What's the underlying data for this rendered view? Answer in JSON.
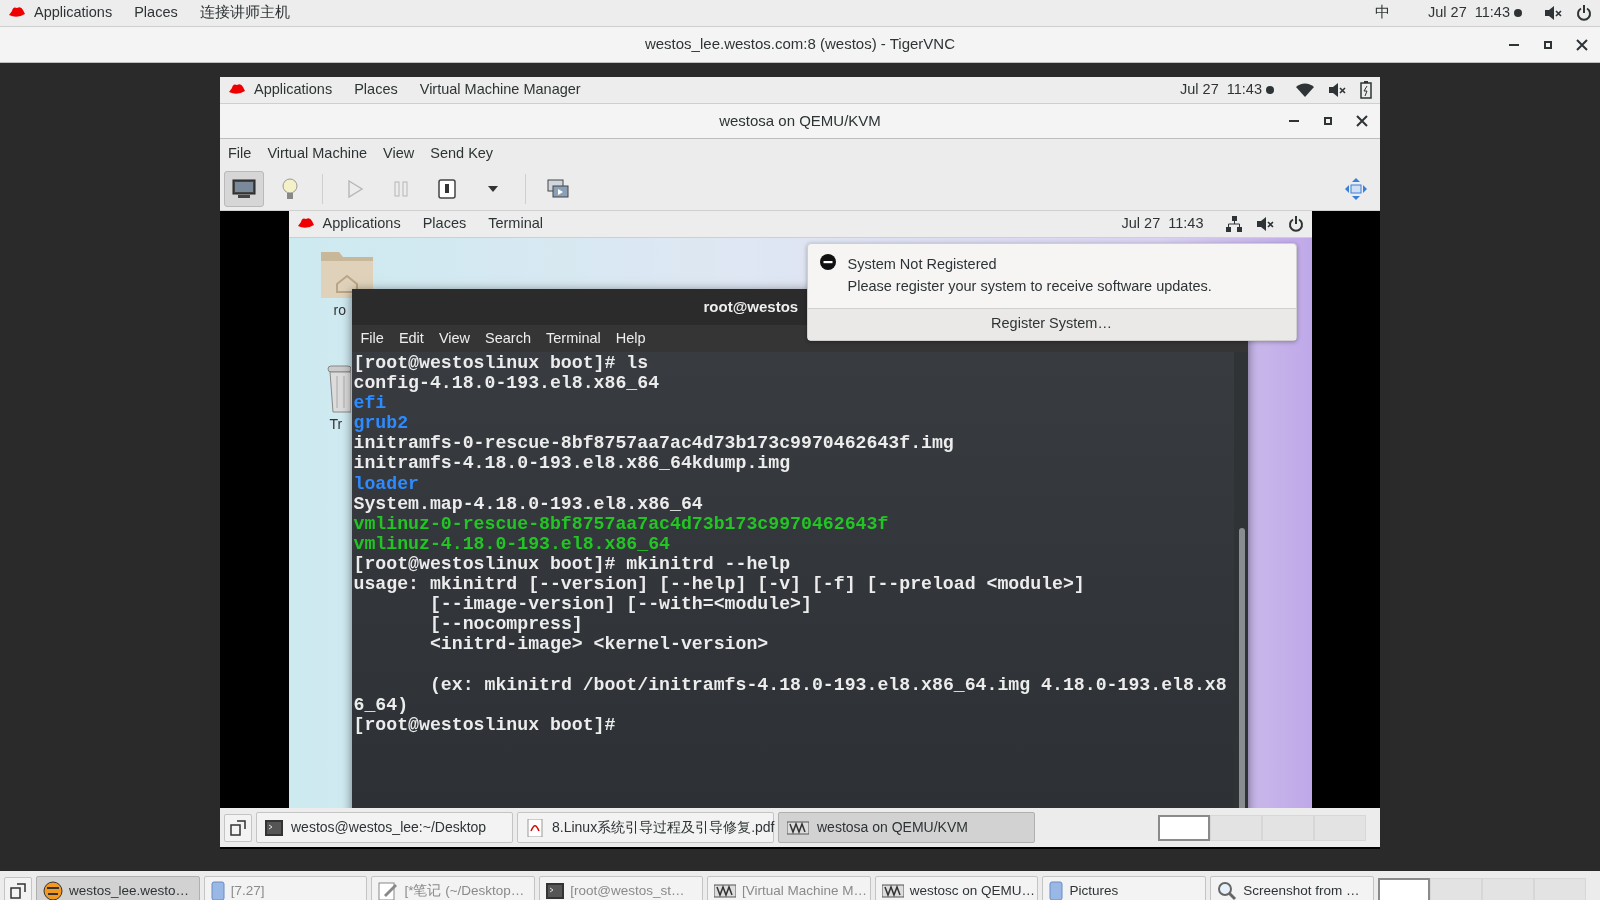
{
  "top_bar": {
    "menus": [
      "Applications",
      "Places",
      "连接讲师主机"
    ],
    "input_method": "中",
    "clock": "Jul 27  11:43"
  },
  "window": {
    "title": "westos_lee.westos.com:8 (westos) - TigerVNC"
  },
  "remote": {
    "top_bar": {
      "menus": [
        "Applications",
        "Places",
        "Virtual Machine Manager"
      ],
      "clock": "Jul 27  11:43"
    },
    "vm_window": {
      "title": "westosa on QEMU/KVM",
      "menu": [
        "File",
        "Virtual Machine",
        "View",
        "Send Key"
      ],
      "toolbar": [
        {
          "kind": "console",
          "selected": true,
          "disabled": false
        },
        {
          "kind": "details",
          "selected": false,
          "disabled": false
        },
        {
          "kind": "run",
          "selected": false,
          "disabled": true
        },
        {
          "kind": "pause",
          "selected": false,
          "disabled": true
        },
        {
          "kind": "shutdown",
          "selected": false,
          "disabled": false
        },
        {
          "kind": "dropdown",
          "selected": false,
          "disabled": false
        },
        {
          "kind": "snapshots",
          "selected": false,
          "disabled": false
        }
      ]
    },
    "guest": {
      "top_bar": {
        "menus": [
          "Applications",
          "Places",
          "Terminal"
        ],
        "clock": "Jul 27  11:43"
      },
      "desktop_icons": [
        {
          "kind": "home",
          "label": "ro"
        },
        {
          "kind": "trash",
          "label": "Tr"
        }
      ],
      "terminal": {
        "title": "root@westos",
        "menu": [
          "File",
          "Edit",
          "View",
          "Search",
          "Terminal",
          "Help"
        ],
        "lines": [
          {
            "kind": "plain",
            "text": "[root@westoslinux boot]# ls"
          },
          {
            "kind": "plain",
            "text": "config-4.18.0-193.el8.x86_64"
          },
          {
            "kind": "dir",
            "text": "efi"
          },
          {
            "kind": "dir",
            "text": "grub2"
          },
          {
            "kind": "plain",
            "text": "initramfs-0-rescue-8bf8757aa7ac4d73b173c9970462643f.img"
          },
          {
            "kind": "plain",
            "text": "initramfs-4.18.0-193.el8.x86_64kdump.img"
          },
          {
            "kind": "dir",
            "text": "loader"
          },
          {
            "kind": "plain",
            "text": "System.map-4.18.0-193.el8.x86_64"
          },
          {
            "kind": "exec",
            "text": "vmlinuz-0-rescue-8bf8757aa7ac4d73b173c9970462643f"
          },
          {
            "kind": "exec",
            "text": "vmlinuz-4.18.0-193.el8.x86_64"
          },
          {
            "kind": "plain",
            "text": "[root@westoslinux boot]# mkinitrd --help"
          },
          {
            "kind": "plain",
            "text": "usage: mkinitrd [--version] [--help] [-v] [-f] [--preload <module>]"
          },
          {
            "kind": "plain",
            "text": "       [--image-version] [--with=<module>]"
          },
          {
            "kind": "plain",
            "text": "       [--nocompress]"
          },
          {
            "kind": "plain",
            "text": "       <initrd-image> <kernel-version>"
          },
          {
            "kind": "blank"
          },
          {
            "kind": "plain",
            "text": "       (ex: mkinitrd /boot/initramfs-4.18.0-193.el8.x86_64.img 4.18.0-193.el8.x8"
          },
          {
            "kind": "plain",
            "text": "6_64)"
          },
          {
            "kind": "plain",
            "text": "[root@westoslinux boot]#"
          }
        ]
      },
      "notification": {
        "title": "System Not Registered",
        "body": "Please register your system to receive software updates.",
        "action": "Register System…"
      }
    },
    "taskbar": {
      "items": [
        {
          "kind": "terminal",
          "label": "westos@westos_lee:~/Desktop",
          "selected": false
        },
        {
          "kind": "pdf",
          "label": "8.Linux系统引导过程及引导修复.pdf",
          "selected": false
        },
        {
          "kind": "vm",
          "label": "westosa on QEMU/KVM",
          "selected": true
        }
      ],
      "workspaces": [
        {
          "selected": true
        },
        {
          "selected": false
        },
        {
          "selected": false
        },
        {
          "selected": false
        }
      ]
    }
  },
  "taskbar": {
    "items": [
      {
        "kind": "vnc",
        "label": "westos_lee.westo…",
        "selected": true,
        "minimized": false
      },
      {
        "kind": "doc",
        "label": "[7.27]",
        "selected": false,
        "minimized": true
      },
      {
        "kind": "editor",
        "label": "[*笔记 (~/Desktop…",
        "selected": false,
        "minimized": true
      },
      {
        "kind": "terminal",
        "label": "[root@westos_st…",
        "selected": false,
        "minimized": true
      },
      {
        "kind": "vm",
        "label": "[Virtual Machine M…",
        "selected": false,
        "minimized": true
      },
      {
        "kind": "vm",
        "label": "westosc on QEMU…",
        "selected": false,
        "minimized": false
      },
      {
        "kind": "doc",
        "label": "Pictures",
        "selected": false,
        "minimized": false
      },
      {
        "kind": "screenshot",
        "label": "Screenshot from …",
        "selected": false,
        "minimized": false
      }
    ],
    "workspaces": [
      {
        "selected": true
      },
      {
        "selected": false
      },
      {
        "selected": false
      },
      {
        "selected": false
      }
    ]
  }
}
